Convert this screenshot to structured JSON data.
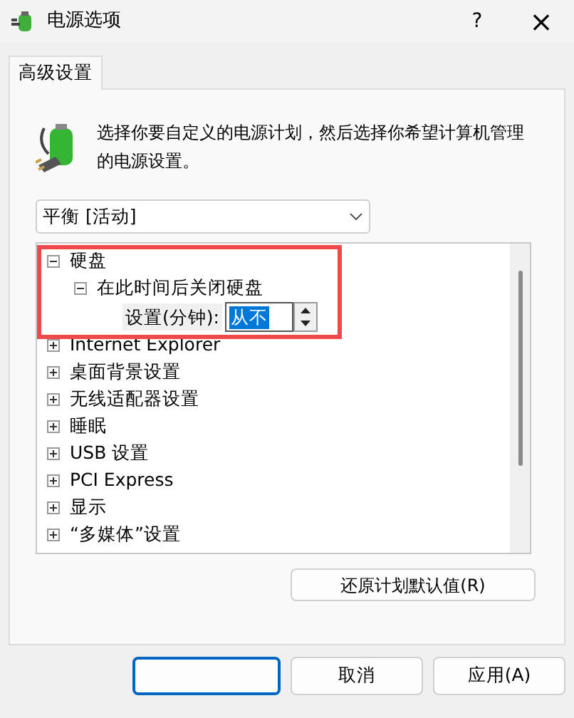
{
  "window": {
    "title": "电源选项",
    "help": "?",
    "close": "×"
  },
  "tabs": [
    {
      "label": "高级设置",
      "selected": true
    }
  ],
  "description": "选择你要自定义的电源计划，然后选择你希望计算机管理的电源设置。",
  "plan_dropdown": {
    "value": "平衡 [活动]"
  },
  "tree": [
    {
      "label": "硬盘",
      "expanded": true,
      "highlighted": true,
      "children": [
        {
          "label": "在此时间后关闭硬盘",
          "expanded": true,
          "setting": {
            "label": "设置(分钟):",
            "value": "从不"
          }
        }
      ]
    },
    {
      "label": "Internet Explorer",
      "expanded": false
    },
    {
      "label": "桌面背景设置",
      "expanded": false
    },
    {
      "label": "无线适配器设置",
      "expanded": false
    },
    {
      "label": "睡眠",
      "expanded": false
    },
    {
      "label": "USB 设置",
      "expanded": false
    },
    {
      "label": "PCI Express",
      "expanded": false
    },
    {
      "label": "显示",
      "expanded": false
    },
    {
      "label": "“多媒体”设置",
      "expanded": false
    }
  ],
  "restore_button": "还原计划默认值(R)",
  "bottom_buttons": [
    {
      "kind": "default"
    },
    {
      "kind": "normal",
      "label": "取消"
    },
    {
      "kind": "normal",
      "label": "应用(A)"
    }
  ]
}
